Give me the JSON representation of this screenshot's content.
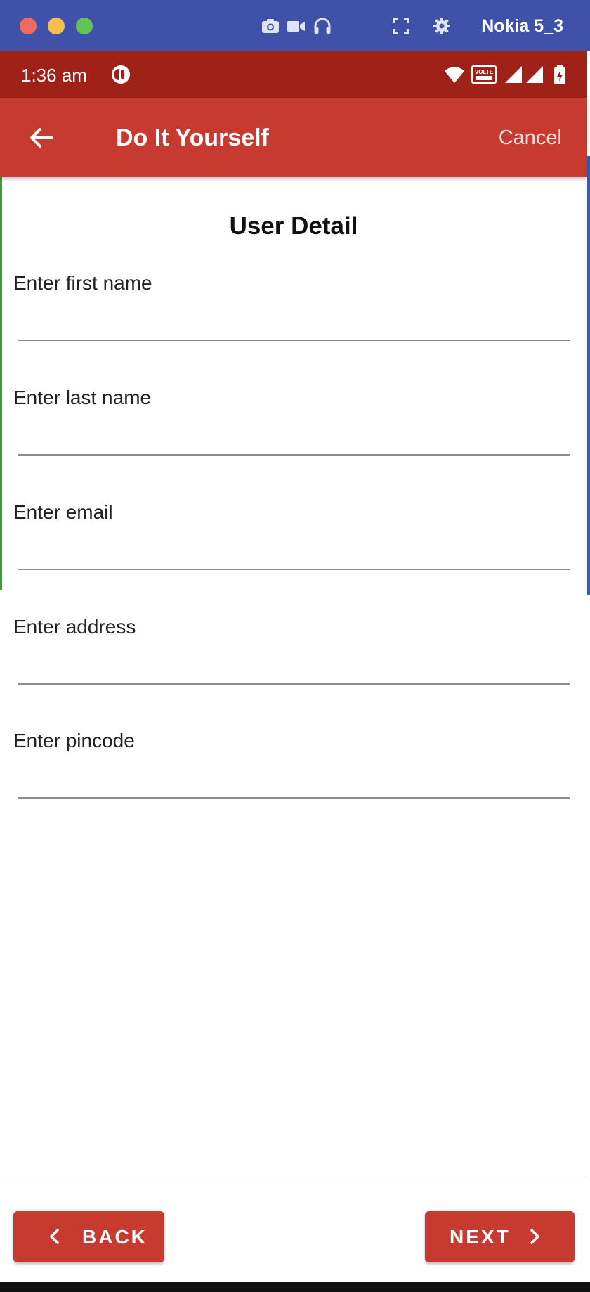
{
  "emulator": {
    "device_name": "Nokia 5_3",
    "icons": [
      "camera-icon",
      "video-icon",
      "headphones-icon",
      "fullscreen-icon",
      "gear-icon"
    ],
    "colors": {
      "bar": "#3f51a9",
      "close": "#ee6a5f",
      "minimize": "#f5be4f",
      "maximize": "#61c454"
    }
  },
  "status_bar": {
    "time": "1:36 am",
    "network_badge": "VOLTE",
    "icons": [
      "app-notification-icon",
      "wifi-icon",
      "volte-icon",
      "signal-icon",
      "signal-icon",
      "battery-icon"
    ]
  },
  "app_bar": {
    "title": "Do It Yourself",
    "cancel_label": "Cancel",
    "back_icon": "arrow-left-icon",
    "color": "#c73a2f"
  },
  "form": {
    "title": "User Detail",
    "fields": [
      {
        "label": "Enter first name",
        "value": ""
      },
      {
        "label": "Enter last name",
        "value": ""
      },
      {
        "label": "Enter email",
        "value": ""
      },
      {
        "label": "Enter address",
        "value": ""
      },
      {
        "label": "Enter pincode",
        "value": ""
      }
    ]
  },
  "footer": {
    "back_label": "BACK",
    "next_label": "NEXT",
    "button_color": "#c73a2f"
  }
}
